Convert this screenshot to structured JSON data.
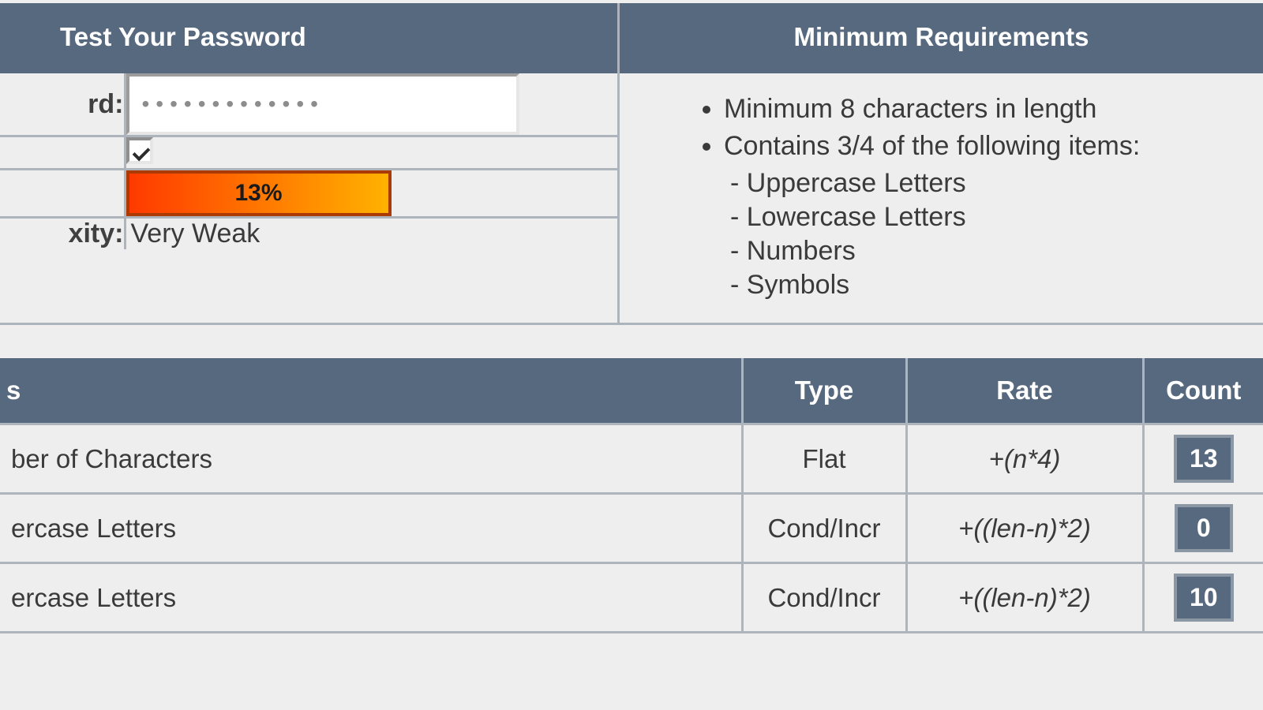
{
  "left_header": "Test Your Password",
  "right_header": "Minimum Requirements",
  "form": {
    "password_label_fragment": "rd:",
    "password_value": "•••••••••••••",
    "hide_checked": true,
    "score_text": "13%",
    "complexity_label_fragment": "xity:",
    "complexity_value": "Very Weak"
  },
  "requirements": {
    "item1": "Minimum 8 characters in length",
    "item2": "Contains 3/4 of the following items:",
    "sub1": "- Uppercase Letters",
    "sub2": "- Lowercase Letters",
    "sub3": "- Numbers",
    "sub4": "- Symbols"
  },
  "columns": {
    "name_fragment": "s",
    "type": "Type",
    "rate": "Rate",
    "count": "Count"
  },
  "rows": [
    {
      "name": "ber of Characters",
      "type": "Flat",
      "rate": "+(n*4)",
      "count": "13"
    },
    {
      "name": "ercase Letters",
      "type": "Cond/Incr",
      "rate": "+((len-n)*2)",
      "count": "0"
    },
    {
      "name": "ercase Letters",
      "type": "Cond/Incr",
      "rate": "+((len-n)*2)",
      "count": "10"
    }
  ]
}
